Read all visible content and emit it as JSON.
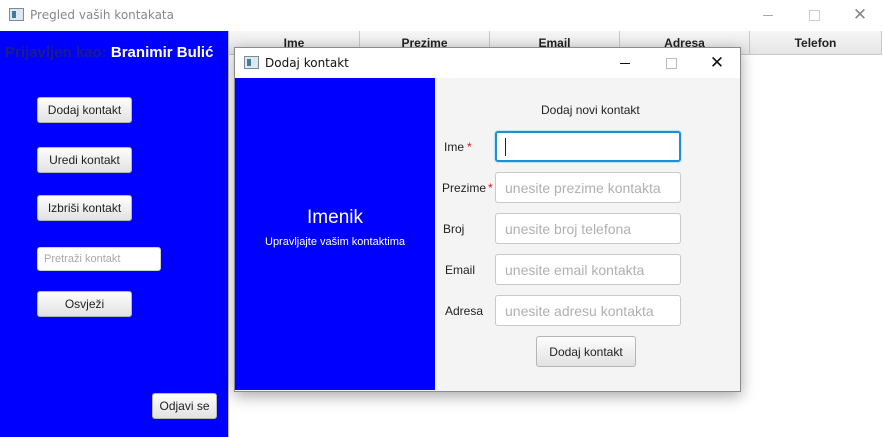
{
  "main_window": {
    "title": "Pregled vaših kontakata",
    "logged_in_label": "Prijavljen kao:",
    "user_name": "Branimir Bulić",
    "buttons": {
      "add": "Dodaj kontakt",
      "edit": "Uredi kontakt",
      "delete": "Izbriši kontakt",
      "refresh": "Osvježi",
      "logout": "Odjavi se"
    },
    "search": {
      "placeholder": "Pretraži kontakt",
      "value": ""
    },
    "table_columns": [
      "Ime",
      "Prezime",
      "Email",
      "Adresa",
      "Telefon"
    ]
  },
  "dialog": {
    "title": "Dodaj kontakt",
    "brand_title": "Imenik",
    "brand_subtitle": "Upravljajte vašim kontaktima",
    "form_heading": "Dodaj novi kontakt",
    "fields": {
      "first_name": {
        "label": "Ime",
        "required": "*",
        "placeholder": "",
        "value": ""
      },
      "last_name": {
        "label": "Prezime",
        "required": "*",
        "placeholder": "unesite prezime kontakta",
        "value": ""
      },
      "phone": {
        "label": "Broj",
        "placeholder": "unesite broj telefona",
        "value": ""
      },
      "email": {
        "label": "Email",
        "placeholder": "unesite email kontakta",
        "value": ""
      },
      "address": {
        "label": "Adresa",
        "placeholder": "unesite adresu kontakta",
        "value": ""
      }
    },
    "submit_label": "Dodaj kontakt"
  },
  "colors": {
    "panel_blue": "#0000ff",
    "focus_ring": "#1e90d4",
    "required": "#e21010"
  },
  "icons": {
    "window_icon": "app-window-icon",
    "minimize": "minimize-icon",
    "maximize": "maximize-icon",
    "close": "close-icon"
  }
}
